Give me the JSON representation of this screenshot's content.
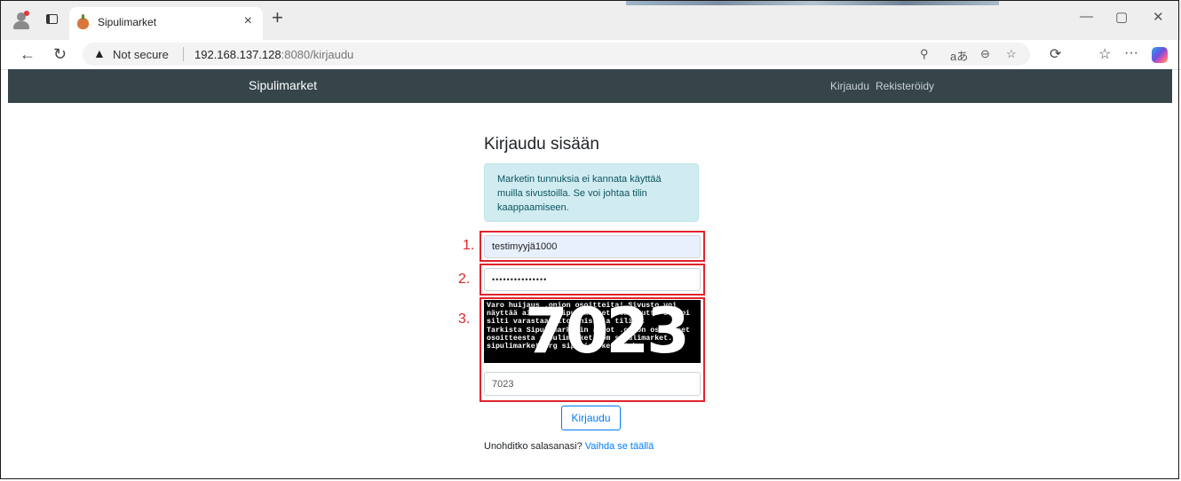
{
  "browser": {
    "tab_title": "Sipulimarket",
    "tab_close": "×",
    "new_tab": "+",
    "security_label": "Not secure",
    "url_host": "192.168.137.128",
    "url_path": ":8080/kirjaudu",
    "window_controls": {
      "minimize": "—",
      "maximize": "▢",
      "close": "✕"
    },
    "icons": [
      "profile-icon",
      "tabs-icon",
      "back-icon",
      "refresh-icon",
      "warning-icon",
      "key-icon",
      "read-aloud-icon",
      "zoom-icon",
      "favorite-star-icon",
      "extensions-icon",
      "favorites-icon",
      "more-icon",
      "copilot-icon"
    ]
  },
  "nav": {
    "brand": "Sipulimarket",
    "login": "Kirjaudu",
    "register": "Rekisteröidy",
    "background_color": "#36454a"
  },
  "page": {
    "heading": "Kirjaudu sisään",
    "alert": "Marketin tunnuksia ei kannata käyttää muilla sivustoilla. Se voi johtaa tilin kaappaamiseen.",
    "username_value": "testimyyjä1000",
    "password_value": "•••••••••••••••",
    "captcha_text": "Varo huijaus .onion osoitteita! Sivusto voi\nnäyttää aidolta sipulimarketilta, mutta se voi\nsilti varastaa aitcoinisi ja tilisi.\nTarkista Sipulimarketin aidot .onion osoitteet\nosoitteesta sipulimarket.com sipulimarket.net\nsipulimarket.org sipulimarket.link",
    "captcha_code": "7023",
    "captcha_input_value": "7023",
    "submit_label": "Kirjaudu",
    "forgot_text": "Unohditko salasanasi?",
    "forgot_link": "Vaihda se täällä"
  },
  "annotations": {
    "labels": [
      "1.",
      "2.",
      "3."
    ],
    "color": "#e0242a"
  }
}
